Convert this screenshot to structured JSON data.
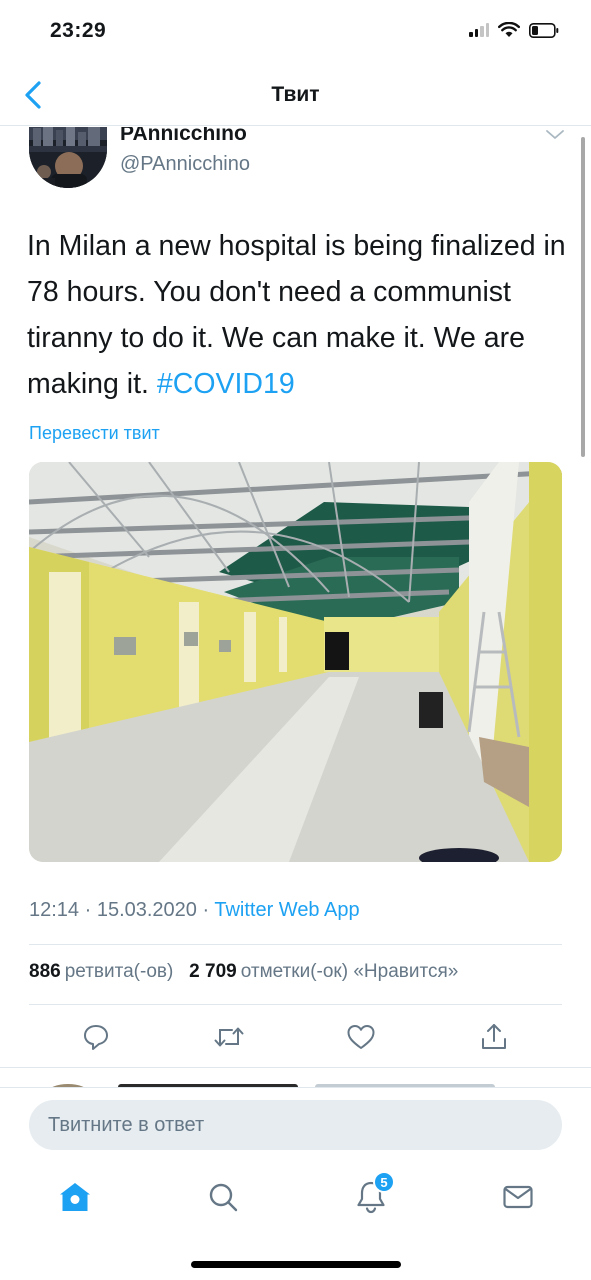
{
  "status_bar": {
    "time": "23:29"
  },
  "nav": {
    "title": "Твит"
  },
  "tweet": {
    "display_name": "PAnnicchino",
    "handle": "@PAnnicchino",
    "text": "In Milan a new hospital is being finalized in 78 hours. You don't need a communist tiranny to do it. We can make it. We are making it. ",
    "hashtag": "#COVID19",
    "translate": "Перевести твит",
    "time_date": "12:14 · 15.03.2020 · ",
    "source": "Twitter Web App",
    "retweets_count": "886",
    "retweets_label": "ретвита(-ов)",
    "likes_count": "2 709",
    "likes_label": "отметки(-ок) «Нравится»"
  },
  "reply": {
    "placeholder": "Твитните в ответ"
  },
  "tabs": {
    "items": [
      "home-icon",
      "search-icon",
      "notifications-icon",
      "messages-icon"
    ],
    "notifications_badge": "5"
  },
  "colors": {
    "accent": "#1da1f2",
    "secondary_text": "#657786",
    "divider": "#e1e8ed"
  }
}
